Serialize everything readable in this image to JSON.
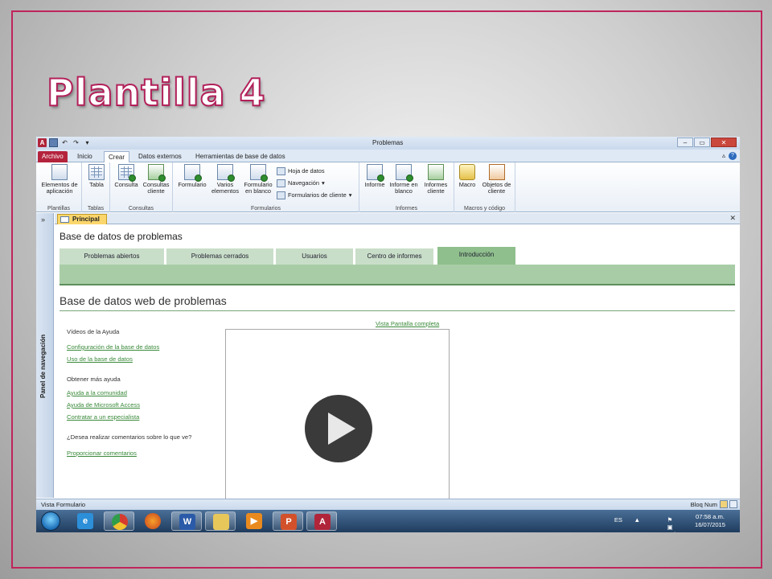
{
  "slide": {
    "title": "Plantilla 4"
  },
  "window": {
    "title": "Problemas",
    "app_icon": "A"
  },
  "quick_access": {
    "undo": "↶",
    "redo": "↷",
    "more": "▾"
  },
  "window_controls": {
    "minimize": "–",
    "restore": "▭",
    "close": "✕"
  },
  "ribbon_tabs": [
    "Archivo",
    "Inicio",
    "Crear",
    "Datos externos",
    "Herramientas de base de datos"
  ],
  "ribbon_groups": {
    "plantillas": {
      "label": "Plantillas",
      "button": "Elementos de aplicación"
    },
    "tablas": {
      "label": "Tablas",
      "button": "Tabla"
    },
    "consultas": {
      "label": "Consultas",
      "buttons": [
        "Consulta",
        "Consultas cliente"
      ]
    },
    "formularios": {
      "label": "Formularios",
      "buttons": [
        "Formulario",
        "Varios elementos",
        "Formulario en blanco"
      ],
      "small": [
        "Hoja de datos",
        "Navegación",
        "Formularios de cliente"
      ]
    },
    "informes": {
      "label": "Informes",
      "buttons": [
        "Informe",
        "Informe en blanco",
        "Informes cliente"
      ]
    },
    "macros": {
      "label": "Macros y código",
      "buttons": [
        "Macro",
        "Objetos de cliente"
      ]
    }
  },
  "nav_pane": {
    "label": "Panel de navegación",
    "toggle": "»"
  },
  "document_tab": {
    "label": "Principal",
    "close": "✕"
  },
  "form": {
    "header": "Base de datos de problemas",
    "tabs": [
      "Problemas abiertos",
      "Problemas cerrados",
      "Usuarios",
      "Centro de informes",
      "Introducción"
    ],
    "active_tab": "Introducción",
    "section_title": "Base de datos web de problemas",
    "fullscreen_link": "Vista Pantalla completa",
    "videos_heading": "Vídeos de la Ayuda",
    "video_links": [
      "Configuración de la base de datos",
      "Uso de la base de datos"
    ],
    "more_help_heading": "Obtener más ayuda",
    "help_links": [
      "Ayuda a la comunidad",
      "Ayuda de Microsoft Access",
      "Contratar a un especialista"
    ],
    "feedback_question": "¿Desea realizar comentarios sobre lo que ve?",
    "feedback_link": "Proporcionar comentarios"
  },
  "status_bar": {
    "left": "Vista Formulario",
    "right": "Bloq Num"
  },
  "taskbar": {
    "language": "ES",
    "time": "07:58 a.m.",
    "date": "16/07/2015",
    "tray_arrow": "▲",
    "tray_icons": "⚑ ▣ ◀)"
  }
}
